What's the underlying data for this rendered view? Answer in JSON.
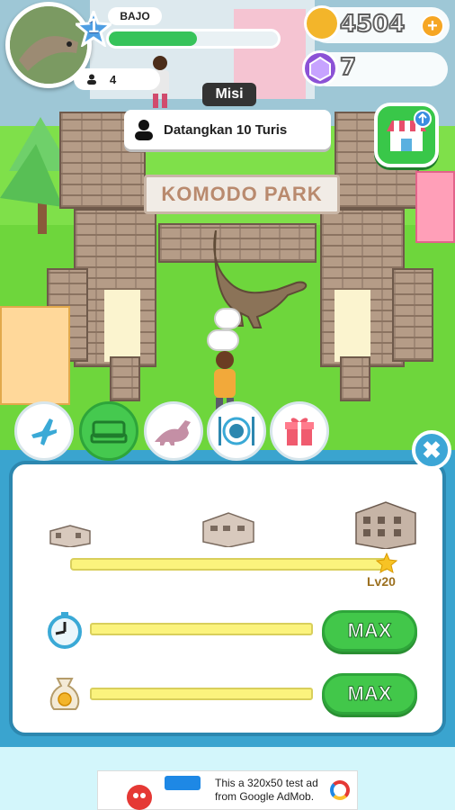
{
  "hud": {
    "player_level": "1",
    "player_name": "BAJO",
    "xp_fraction": 0.52,
    "visitor_count": "4",
    "coins": "4504",
    "add_coin_label": "+",
    "gems": "7"
  },
  "mission": {
    "label": "Misi",
    "text": "Datangkan 10 Turis"
  },
  "park": {
    "sign": "KOMODO PARK"
  },
  "tabs": [
    "airplane-icon",
    "bed-icon",
    "dinosaur-icon",
    "plate-icon",
    "gift-icon"
  ],
  "upgrade_panel": {
    "close_label": "✖",
    "progress_level": "Lv20",
    "progress_fraction": 1.0,
    "speed_button": "MAX",
    "income_button": "MAX",
    "speed_fraction": 1.0,
    "income_fraction": 1.0
  },
  "ad": {
    "text": "This a 320x50 test ad from Google AdMob."
  },
  "colors": {
    "panel_border": "#2c87af",
    "button_green": "#42c74a",
    "bar_yellow": "#fbf37d",
    "grass": "#7fe04a"
  }
}
